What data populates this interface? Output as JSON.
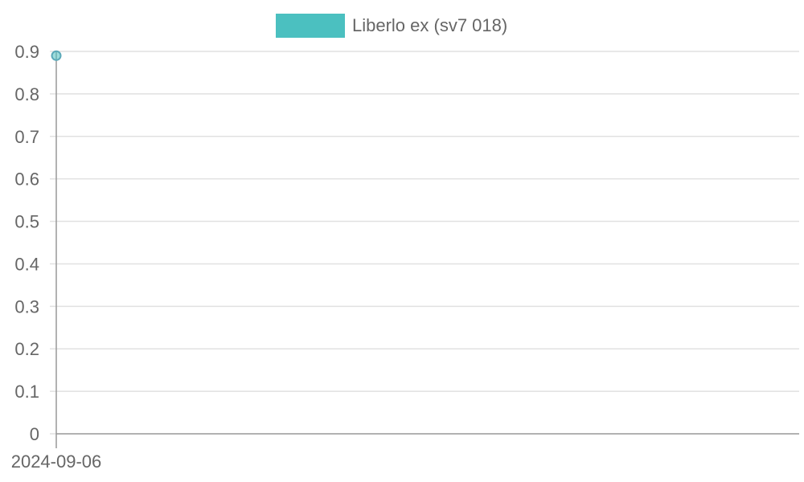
{
  "chart_data": {
    "type": "line",
    "x": [
      "2024-09-06"
    ],
    "series": [
      {
        "name": "Liberlo ex (sv7 018)",
        "values": [
          0.89
        ],
        "color": "#4bc0c0"
      }
    ],
    "ylim": [
      0,
      0.9
    ],
    "yticks": [
      "0",
      "0.1",
      "0.2",
      "0.3",
      "0.4",
      "0.5",
      "0.6",
      "0.7",
      "0.8",
      "0.9"
    ],
    "xticks": [
      "2024-09-06"
    ],
    "grid": true,
    "legend_position": "top-center"
  }
}
